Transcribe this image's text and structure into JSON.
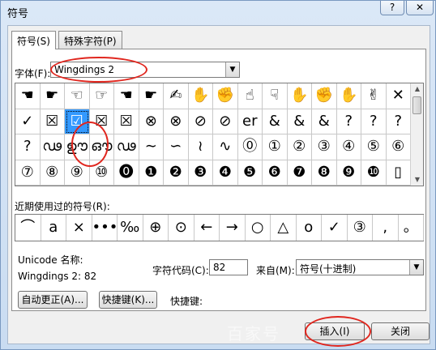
{
  "window": {
    "title": "符号",
    "help_label": "?",
    "close_label": "✕"
  },
  "tabs": [
    {
      "label": "符号(S)"
    },
    {
      "label": "特殊字符(P)"
    }
  ],
  "font": {
    "label": "字体(F):",
    "value": "Wingdings 2"
  },
  "symbol_grid": [
    [
      "☚",
      "☛",
      "☜",
      "☞",
      "☚",
      "☛",
      "✍",
      "✋",
      "✊",
      "☝",
      "☟",
      "✋",
      "✊",
      "✋",
      "✌",
      "✕"
    ],
    [
      "✓",
      "☒",
      "☑",
      "☒",
      "☒",
      "⊗",
      "⊗",
      "⊘",
      "⊘",
      "er",
      "&",
      "&",
      "&",
      "?",
      "?",
      "?"
    ],
    [
      "?",
      "ഢ",
      "ഊ",
      "ഔ",
      "ഢ",
      "∼",
      "∽",
      "≀",
      "∿",
      "⓪",
      "①",
      "②",
      "③",
      "④",
      "⑤",
      "⑥"
    ],
    [
      "⑦",
      "⑧",
      "⑨",
      "⑩",
      "⓿",
      "❶",
      "❷",
      "❸",
      "❹",
      "❺",
      "❻",
      "❼",
      "❽",
      "❾",
      "❿",
      "▯"
    ]
  ],
  "selected_cell": {
    "row": 1,
    "col": 2
  },
  "recent": {
    "label": "近期使用过的符号(R):",
    "symbols": [
      "⌒",
      "a",
      "×",
      "•••",
      "‰",
      "⊕",
      "⊙",
      "←",
      "→",
      "○",
      "△",
      "o",
      "✓",
      "③",
      ",",
      "。"
    ]
  },
  "unicode_name": {
    "label": "Unicode 名称:",
    "value": "Wingdings 2: 82"
  },
  "char_code": {
    "label": "字符代码(C):",
    "value": "82"
  },
  "from": {
    "label": "来自(M):",
    "value": "符号(十进制)"
  },
  "buttons": {
    "autocorrect": "自动更正(A)...",
    "shortcut": "快捷键(K)...",
    "insert": "插入(I)",
    "close": "关闭"
  },
  "shortcut_key_label": "快捷键:",
  "watermark": "百家号"
}
